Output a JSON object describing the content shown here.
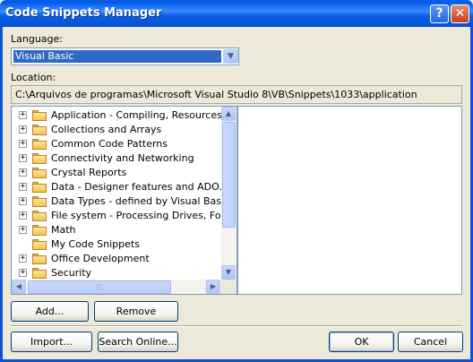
{
  "window": {
    "title": "Code Snippets Manager",
    "help_glyph": "?",
    "close_glyph": "✕"
  },
  "language": {
    "label": "Language:",
    "selected": "Visual Basic"
  },
  "location": {
    "label": "Location:",
    "path": "C:\\Arquivos de programas\\Microsoft Visual Studio 8\\VB\\Snippets\\1033\\application"
  },
  "tree": {
    "items": [
      {
        "label": "Application - Compiling, Resources, and",
        "expandable": true
      },
      {
        "label": "Collections and Arrays",
        "expandable": true
      },
      {
        "label": "Common Code Patterns",
        "expandable": true
      },
      {
        "label": "Connectivity and Networking",
        "expandable": true
      },
      {
        "label": "Crystal Reports",
        "expandable": true
      },
      {
        "label": "Data - Designer features and ADO.NET",
        "expandable": true
      },
      {
        "label": "Data Types - defined by Visual Basic",
        "expandable": true
      },
      {
        "label": "File system - Processing Drives, Folders",
        "expandable": true
      },
      {
        "label": "Math",
        "expandable": true
      },
      {
        "label": "My Code Snippets",
        "expandable": false
      },
      {
        "label": "Office Development",
        "expandable": true
      },
      {
        "label": "Security",
        "expandable": true
      }
    ],
    "expand_glyph": "+"
  },
  "buttons": {
    "add": "Add...",
    "remove": "Remove",
    "import": "Import...",
    "search_online": "Search Online...",
    "ok": "OK",
    "cancel": "Cancel"
  },
  "colors": {
    "titlebar": "#0058ee",
    "selection": "#316ac5",
    "dialog_bg": "#ece9d8"
  }
}
